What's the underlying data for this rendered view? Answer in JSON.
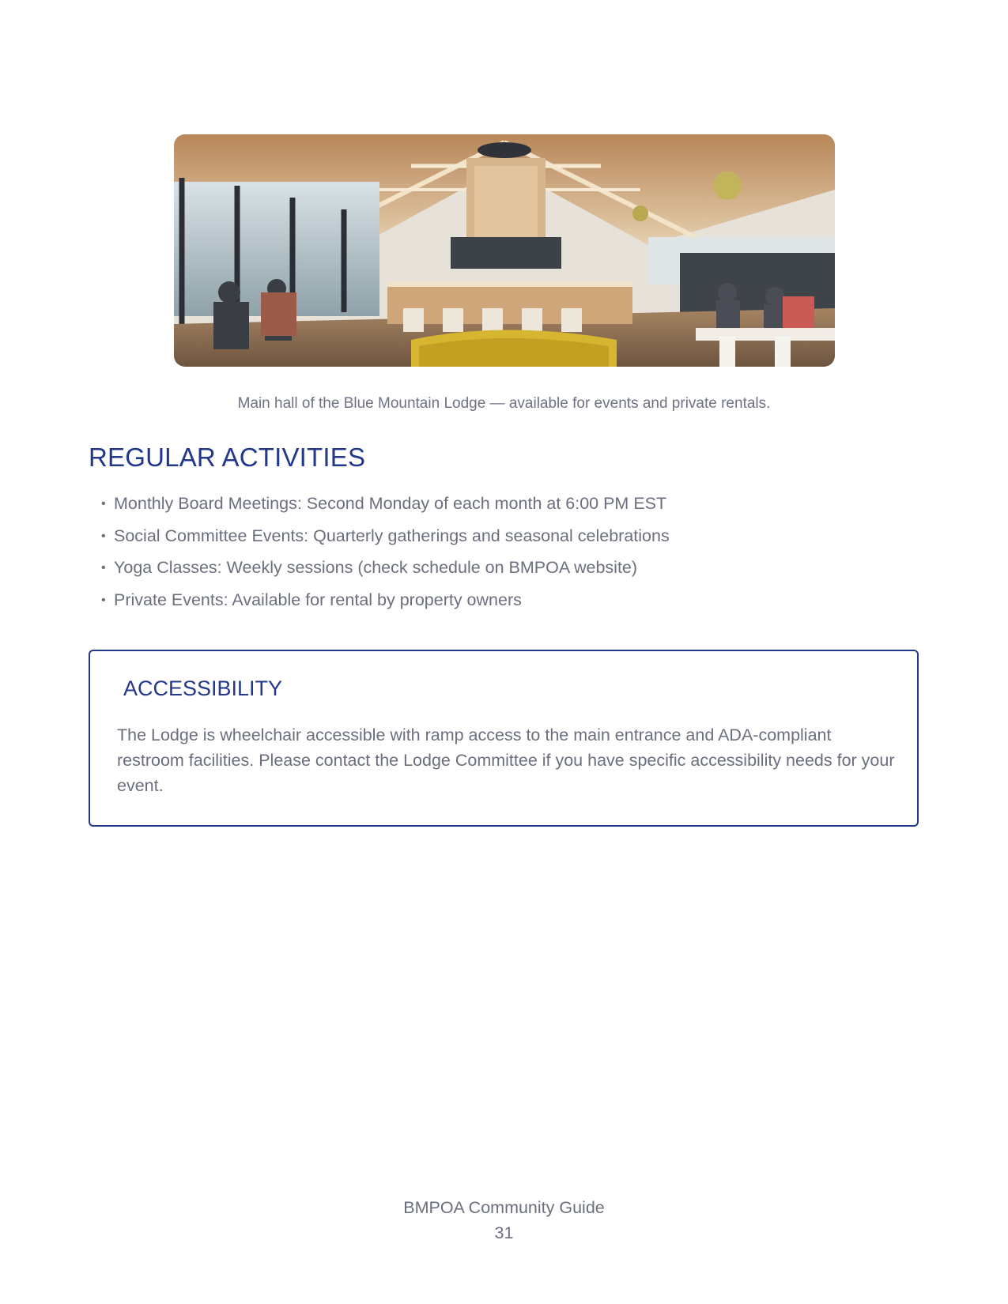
{
  "photo": {
    "subject": "Main hall interior photograph",
    "colors": {
      "ceiling": "#c9a57e",
      "wood": "#d7b58d",
      "wall": "#e9e6df",
      "window": "#b9c3c8",
      "floor": "#8b6e4e",
      "sofa": "#d6b531",
      "dark": "#2f3238"
    }
  },
  "caption": "Main hall of the Blue Mountain Lodge — available for events and private rentals.",
  "activities": {
    "title": "REGULAR ACTIVITIES",
    "bullet": "•",
    "items": [
      "Monthly Board Meetings: Second Monday of each month at 6:00 PM EST",
      "Social Committee Events: Quarterly gatherings and seasonal celebrations",
      "Yoga Classes: Weekly sessions (check schedule on BMPOA website)",
      "Private Events: Available for rental by property owners"
    ]
  },
  "accessibility": {
    "title": "ACCESSIBILITY",
    "body": "The Lodge is wheelchair accessible with ramp access to the main entrance and ADA-compliant restroom facilities. Please contact the Lodge Committee if you have specific accessibility needs for your event."
  },
  "footer": {
    "guide_name": "BMPOA Community Guide",
    "page_number": "31"
  },
  "colors": {
    "heading": "#24388a",
    "body_text": "#6b6f7d"
  }
}
